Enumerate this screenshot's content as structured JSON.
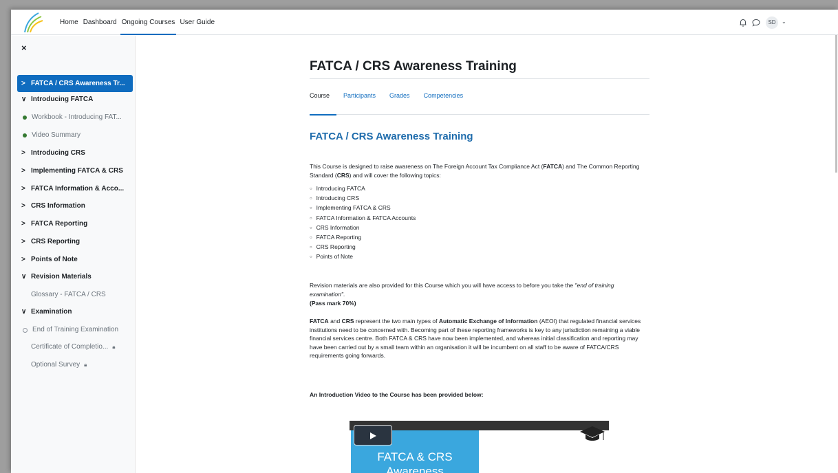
{
  "topnav": {
    "links": [
      "Home",
      "Dashboard",
      "Ongoing Courses",
      "User Guide"
    ],
    "active_index": 2,
    "user_initials": "SD"
  },
  "drawer": {
    "close_glyph": "×",
    "items": [
      {
        "type": "section",
        "label": "FATCA / CRS Awareness Tr...",
        "chevron": ">",
        "active": true
      },
      {
        "type": "section",
        "label": "Introducing FATCA",
        "chevron": "∨"
      },
      {
        "type": "activity",
        "label": "Workbook - Introducing FAT...",
        "status": "complete"
      },
      {
        "type": "activity",
        "label": "Video Summary",
        "status": "complete"
      },
      {
        "type": "section",
        "label": "Introducing CRS",
        "chevron": ">"
      },
      {
        "type": "section",
        "label": "Implementing FATCA & CRS",
        "chevron": ">"
      },
      {
        "type": "section",
        "label": "FATCA Information & Acco...",
        "chevron": ">"
      },
      {
        "type": "section",
        "label": "CRS Information",
        "chevron": ">"
      },
      {
        "type": "section",
        "label": "FATCA Reporting",
        "chevron": ">"
      },
      {
        "type": "section",
        "label": "CRS Reporting",
        "chevron": ">"
      },
      {
        "type": "section",
        "label": "Points of Note",
        "chevron": ">"
      },
      {
        "type": "section",
        "label": "Revision Materials",
        "chevron": "∨"
      },
      {
        "type": "activity",
        "label": "Glossary - FATCA / CRS",
        "status": "none"
      },
      {
        "type": "section",
        "label": "Examination",
        "chevron": "∨"
      },
      {
        "type": "activity",
        "label": "End of Training Examination",
        "status": "incomplete"
      },
      {
        "type": "activity",
        "label": "Certificate of Completio...",
        "status": "locked"
      },
      {
        "type": "activity",
        "label": "Optional Survey",
        "status": "locked"
      }
    ]
  },
  "main": {
    "page_title": "FATCA / CRS Awareness Training",
    "tabs": [
      "Course",
      "Participants",
      "Grades",
      "Competencies"
    ],
    "active_tab": 0,
    "content_title": "FATCA / CRS Awareness Training",
    "intro_parts": [
      "This Course is designed to raise awareness on The Foreign Account Tax Compliance Act (",
      "FATCA",
      ") and The Common Reporting Standard (",
      "CRS",
      ") and will cover the following topics:"
    ],
    "topics": [
      "Introducing FATCA",
      "Introducing CRS",
      "Implementing FATCA & CRS",
      "FATCA Information & FATCA Accounts",
      "CRS Information",
      "FATCA Reporting",
      "CRS Reporting",
      "Points of Note"
    ],
    "revision_text": "Revision materials are also provided for this Course which you will have access to before you take the ",
    "revision_quote": "\"end of training examination\"",
    "revision_end": ".",
    "pass_mark": "(Pass mark 70%)",
    "aeoi_parts": [
      "FATCA",
      " and ",
      "CRS",
      " represent the two main types of ",
      "Automatic Exchange of Information",
      " (AEOI) that regulated financial services institutions need to be concerned with. Becoming part of these reporting frameworks is key to any jurisdiction remaining a viable financial services centre. Both FATCA & CRS have now been implemented, and whereas initial classification and reporting may have been carried out by a small team within an organisation it will be incumbent on all staff to be aware of FATCA/CRS requirements going forwards."
    ],
    "video_heading": "An Introduction Video to the Course has been provided below:",
    "video_title": "FATCA & CRS Awareness"
  },
  "colors": {
    "accent": "#0f6cbf",
    "heading": "#1f6cac",
    "complete": "#357a32",
    "video_blue": "#3aa7de"
  }
}
